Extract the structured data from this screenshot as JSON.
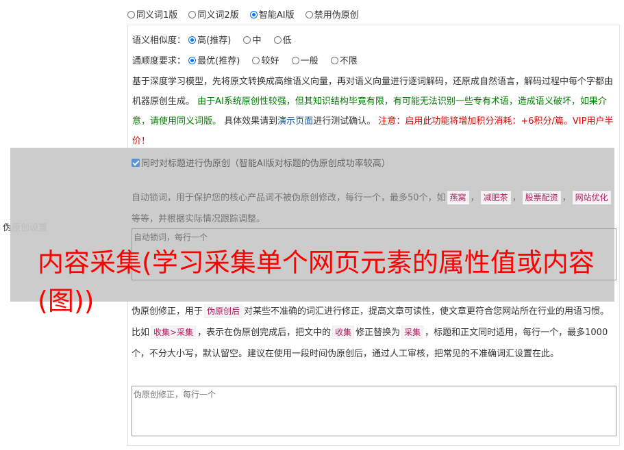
{
  "version_options": [
    {
      "label": "同义词1版",
      "checked": false
    },
    {
      "label": "同义词2版",
      "checked": false
    },
    {
      "label": "智能AI版",
      "checked": true
    },
    {
      "label": "禁用伪原创",
      "checked": false
    }
  ],
  "settings_label": "伪原创设置",
  "similarity": {
    "label": "语义相似度：",
    "options": [
      {
        "label": "高(推荐)",
        "checked": true
      },
      {
        "label": "中",
        "checked": false
      },
      {
        "label": "低",
        "checked": false
      }
    ]
  },
  "fluency": {
    "label": "通顺度要求：",
    "options": [
      {
        "label": "最优(推荐)",
        "checked": true
      },
      {
        "label": "较好",
        "checked": false
      },
      {
        "label": "一般",
        "checked": false
      },
      {
        "label": "不限",
        "checked": false
      }
    ]
  },
  "description": {
    "p1": "基于深度学习模型，先将原文转换成高维语义向量，再对语义向量进行逐词解码，还原成自然语言，解码过程中每个字都由机器原创生成。",
    "p2_green": "由于AI系统原创性较强，但其知识结构毕竟有限，有可能无法识别一些专有术语，造成语义破坏，如果介意，请使用同义词版。",
    "p3_a": "具体效果请到",
    "p3_link": "演示页面",
    "p3_b": "进行测试确认。",
    "p4_red": "注意：启用此功能将增加积分消耗：+6积分/篇。VIP用户半价！"
  },
  "title_checkbox": "同时对标题进行伪原创（智能AI版对标题的伪原创成功率较高）",
  "lock": {
    "text_a": "自动锁词，用于保护您的核心产品词不被伪原创修改，每行一个，最多50个，如",
    "examples": [
      "燕窝",
      "减肥茶",
      "股票配资",
      "网站优化"
    ],
    "text_b": "等等，并根据实际情况跟踪调整。",
    "placeholder": "自动锁词，每行一个"
  },
  "overlay_title": "内容采集(学习采集单个网页元素的属性值或内容(图))",
  "correction": {
    "t1": "伪原创修正，用于",
    "tag1": "伪原创后",
    "t2": "对某些不准确的词汇进行修正，提高文章可读性，使文章更符合您网站所在行业的用语习惯。比如",
    "tag2": "收集>采集",
    "t3": "，表示在伪原创完成后，把文中的",
    "tag3": "收集",
    "t4": "修正替换为",
    "tag4": "采集",
    "t5": "，标题和正文同时适用，每行一个，最多1000个，不分大小写，默认留空。建议在使用一段时间伪原创后，通过人工审核，把常见的不准确词汇设置在此。",
    "placeholder": "伪原创修正，每行一个"
  }
}
